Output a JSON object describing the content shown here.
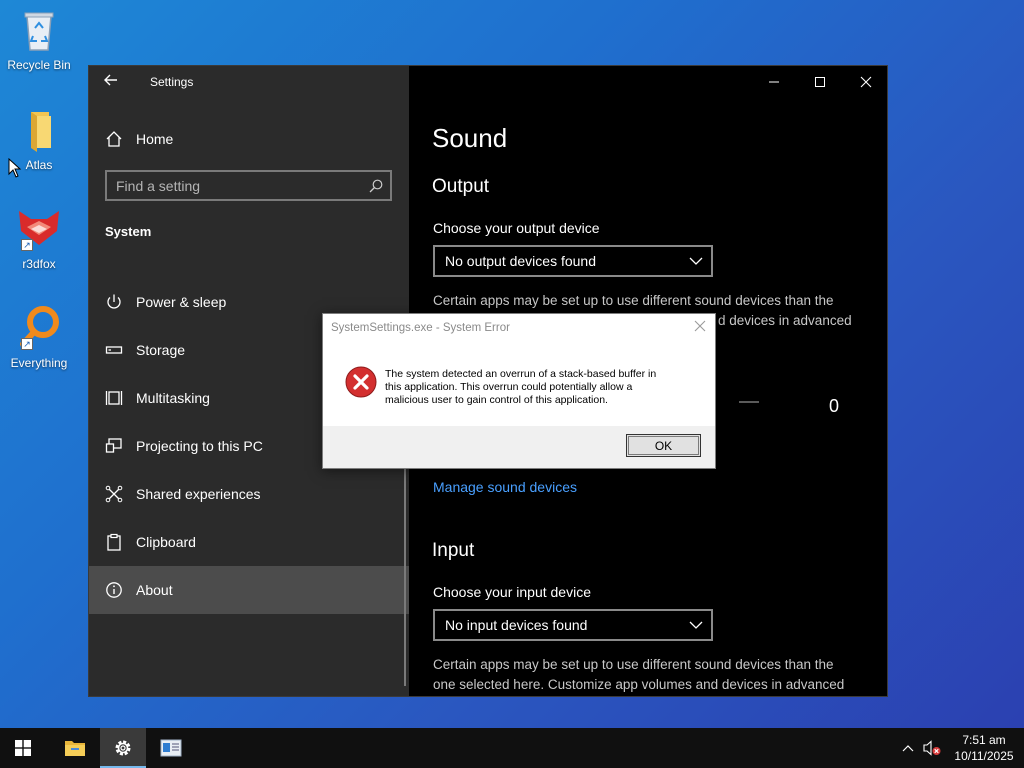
{
  "desktop": {
    "icons": [
      {
        "label": "Recycle Bin",
        "icon": "recycle-bin-icon"
      },
      {
        "label": "Atlas",
        "icon": "folder-icon"
      },
      {
        "label": "r3dfox",
        "icon": "r3dfox-icon"
      },
      {
        "label": "Everything",
        "icon": "everything-search-icon"
      }
    ]
  },
  "settings": {
    "app_title": "Settings",
    "home_label": "Home",
    "search_placeholder": "Find a setting",
    "section_label": "System",
    "nav": [
      {
        "label": "Power & sleep",
        "icon": "power-icon"
      },
      {
        "label": "Storage",
        "icon": "storage-icon"
      },
      {
        "label": "Multitasking",
        "icon": "multitasking-icon"
      },
      {
        "label": "Projecting to this PC",
        "icon": "projecting-icon"
      },
      {
        "label": "Shared experiences",
        "icon": "shared-experiences-icon"
      },
      {
        "label": "Clipboard",
        "icon": "clipboard-icon"
      },
      {
        "label": "About",
        "icon": "info-icon",
        "active": true
      }
    ],
    "main": {
      "page_title": "Sound",
      "output": {
        "heading": "Output",
        "choose_label": "Choose your output device",
        "selected_device": "No output devices found",
        "desc_line1": "Certain apps may be set up to use different sound devices than the",
        "desc_line2_fragment": "d devices in advanced",
        "volume_value": "0",
        "manage_link": "Manage sound devices"
      },
      "input": {
        "heading": "Input",
        "choose_label": "Choose your input device",
        "selected_device": "No input devices found",
        "desc_line1": "Certain apps may be set up to use different sound devices than the",
        "desc_line2": "one selected here. Customize app volumes and devices in advanced"
      }
    }
  },
  "dialog": {
    "title": "SystemSettings.exe - System Error",
    "message_line1": "The system detected an overrun of a stack-based buffer in",
    "message_line2": "this application. This overrun could potentially allow a",
    "message_line3": "malicious user to gain control of this application.",
    "ok_label": "OK"
  },
  "taskbar": {
    "time": "7:51 am",
    "date": "10/11/2025"
  },
  "colors": {
    "accent_link": "#4aa0ff",
    "error_red": "#d32f2f",
    "active_nav": "#4c4c4c"
  }
}
